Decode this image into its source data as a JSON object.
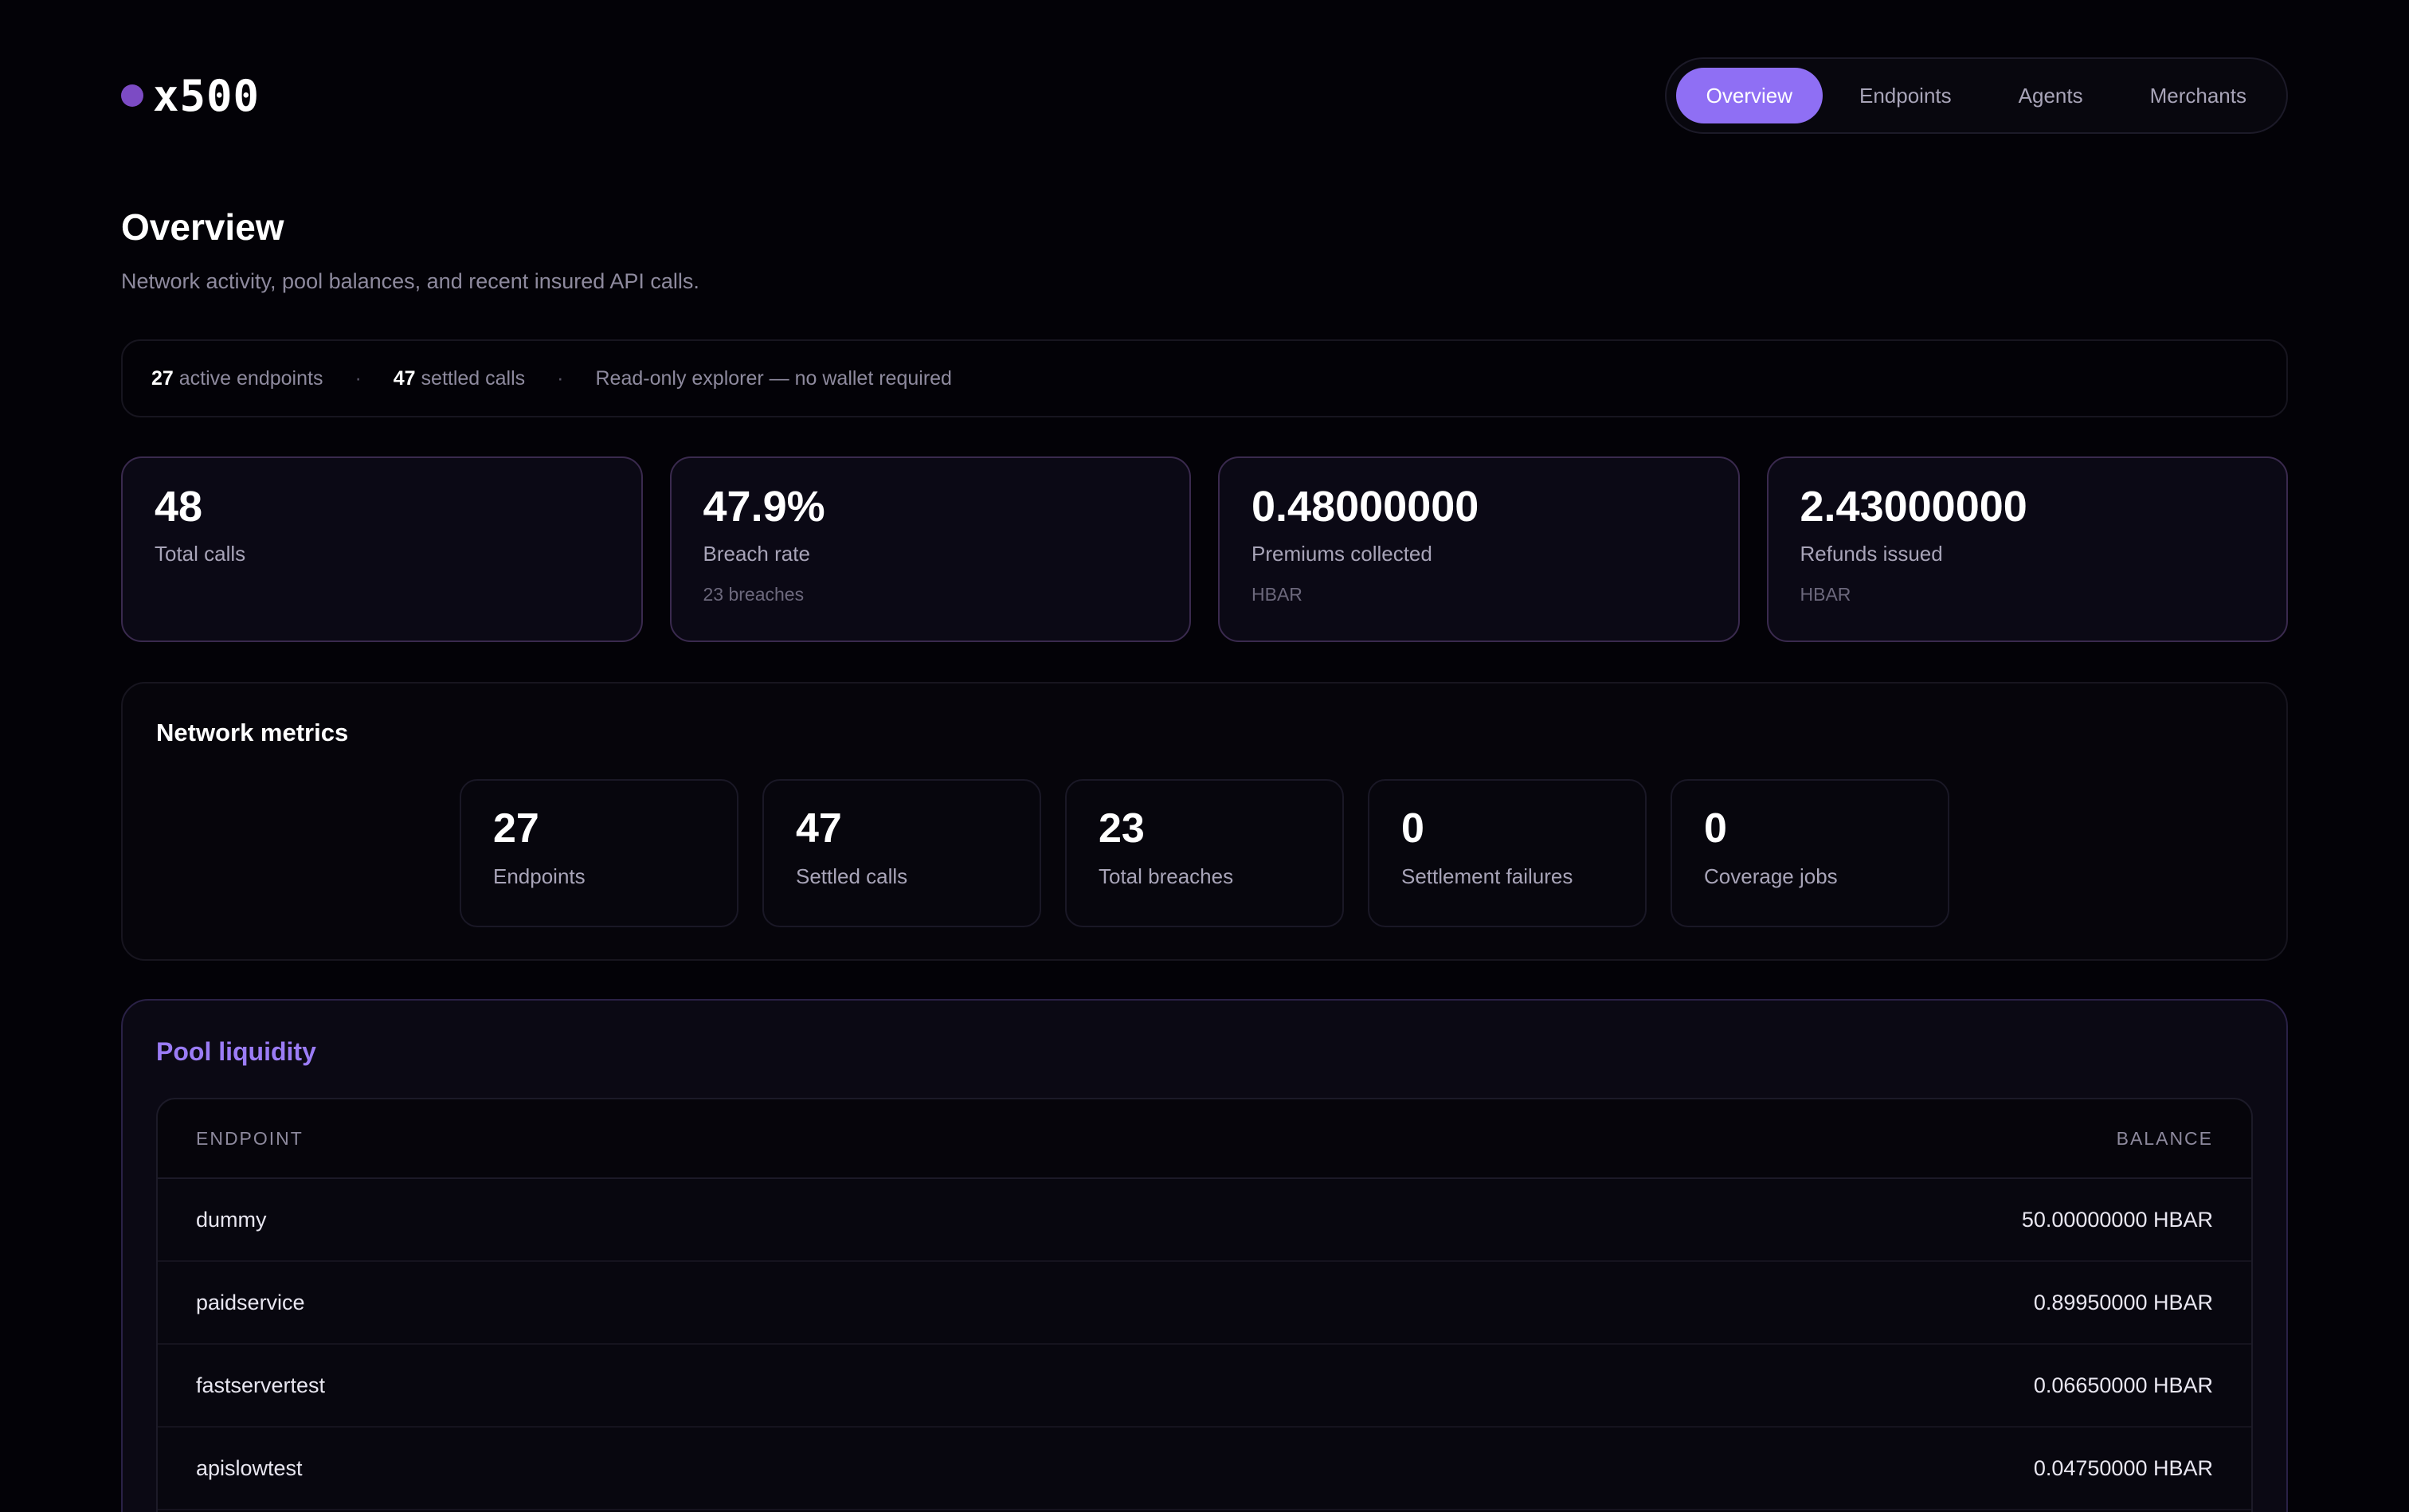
{
  "brand": {
    "name": "x500",
    "dot_color": "#7c4bc4"
  },
  "nav": {
    "items": [
      {
        "label": "Overview",
        "active": true
      },
      {
        "label": "Endpoints",
        "active": false
      },
      {
        "label": "Agents",
        "active": false
      },
      {
        "label": "Merchants",
        "active": false
      }
    ]
  },
  "page": {
    "title": "Overview",
    "subtitle": "Network activity, pool balances, and recent insured API calls."
  },
  "summary": {
    "active_endpoints_count": "27",
    "active_endpoints_label": "active endpoints",
    "settled_calls_count": "47",
    "settled_calls_label": "settled calls",
    "separator": "·",
    "note": "Read-only explorer — no wallet required"
  },
  "stats": [
    {
      "value": "48",
      "label": "Total calls",
      "sub": ""
    },
    {
      "value": "47.9%",
      "label": "Breach rate",
      "sub": "23 breaches"
    },
    {
      "value": "0.48000000",
      "label": "Premiums collected",
      "sub": "HBAR"
    },
    {
      "value": "2.43000000",
      "label": "Refunds issued",
      "sub": "HBAR"
    }
  ],
  "metrics": {
    "title": "Network metrics",
    "tiles": [
      {
        "value": "27",
        "label": "Endpoints"
      },
      {
        "value": "47",
        "label": "Settled calls"
      },
      {
        "value": "23",
        "label": "Total breaches"
      },
      {
        "value": "0",
        "label": "Settlement failures"
      },
      {
        "value": "0",
        "label": "Coverage jobs"
      }
    ]
  },
  "pool": {
    "title": "Pool liquidity",
    "columns": {
      "endpoint": "ENDPOINT",
      "balance": "BALANCE"
    },
    "rows": [
      {
        "endpoint": "dummy",
        "balance": "50.00000000 HBAR"
      },
      {
        "endpoint": "paidservice",
        "balance": "0.89950000 HBAR"
      },
      {
        "endpoint": "fastservertest",
        "balance": "0.06650000 HBAR"
      },
      {
        "endpoint": "apislowtest",
        "balance": "0.04750000 HBAR"
      }
    ]
  },
  "colors": {
    "accent": "#8f6ff4",
    "pool_title": "#9b7cf6",
    "background": "#030207"
  }
}
